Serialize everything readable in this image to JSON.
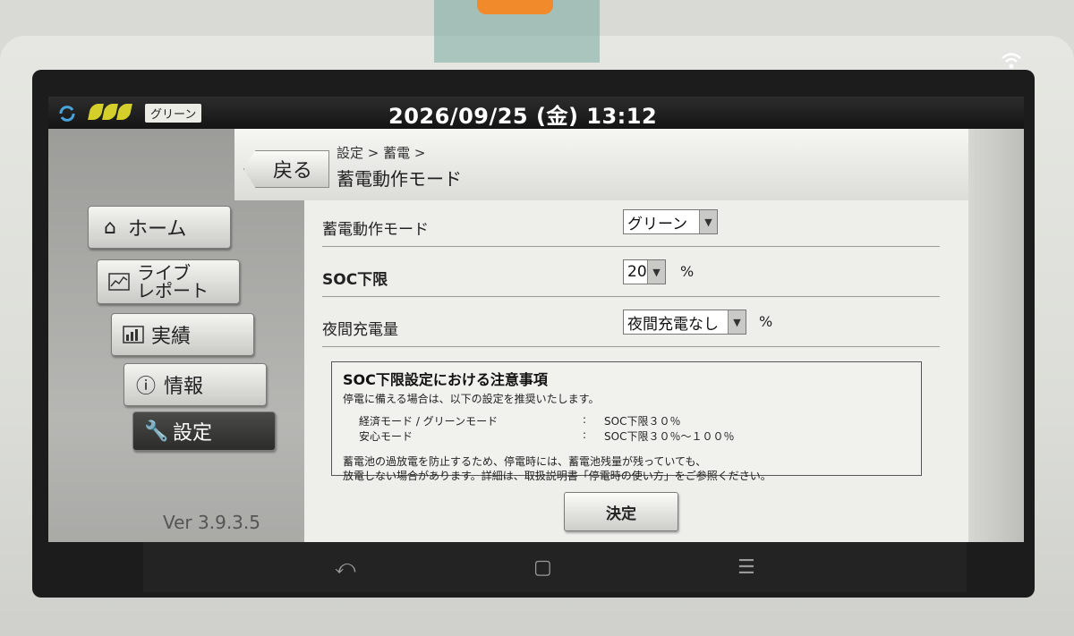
{
  "status_bar": {
    "mode_badge": "グリーン",
    "datetime": "2026/09/25 (金) 13:12"
  },
  "sidebar": {
    "items": [
      {
        "label": "ホーム",
        "icon": "home-icon"
      },
      {
        "label_line1": "ライブ",
        "label_line2": "レポート",
        "icon": "line-chart-icon"
      },
      {
        "label": "実績",
        "icon": "bar-chart-icon"
      },
      {
        "label": "情報",
        "icon": "info-icon"
      },
      {
        "label": "設定",
        "icon": "wrench-icon",
        "active": true
      }
    ],
    "version": "Ver 3.9.3.5"
  },
  "header": {
    "back_label": "戻る",
    "breadcrumb": "設定 > 蓄電 >",
    "title": "蓄電動作モード"
  },
  "settings": {
    "mode": {
      "label": "蓄電動作モード",
      "value": "グリーン"
    },
    "soc": {
      "label": "SOC下限",
      "value": "20",
      "unit": "%"
    },
    "night": {
      "label": "夜間充電量",
      "value": "夜間充電なし",
      "unit": "%"
    }
  },
  "notice": {
    "title": "SOC下限設定における注意事項",
    "intro": "停電に備える場合は、以下の設定を推奨いたします。",
    "rows": [
      {
        "mode": "経済モード / グリーンモード",
        "sep": ":",
        "value": "SOC下限３０％"
      },
      {
        "mode": "安心モード",
        "sep": ":",
        "value": "SOC下限３０％～１００％"
      }
    ],
    "foot_line1": "蓄電池の過放電を防止するため、停電時には、蓄電池残量が残っていても、",
    "foot_line2": "放電しない場合があります。詳細は、取扱説明書「停電時の使い方」をご参照ください。"
  },
  "confirm_label": "決定",
  "colors": {
    "leaf": "#d4cf2a",
    "active_nav": "#2c2c2a"
  }
}
